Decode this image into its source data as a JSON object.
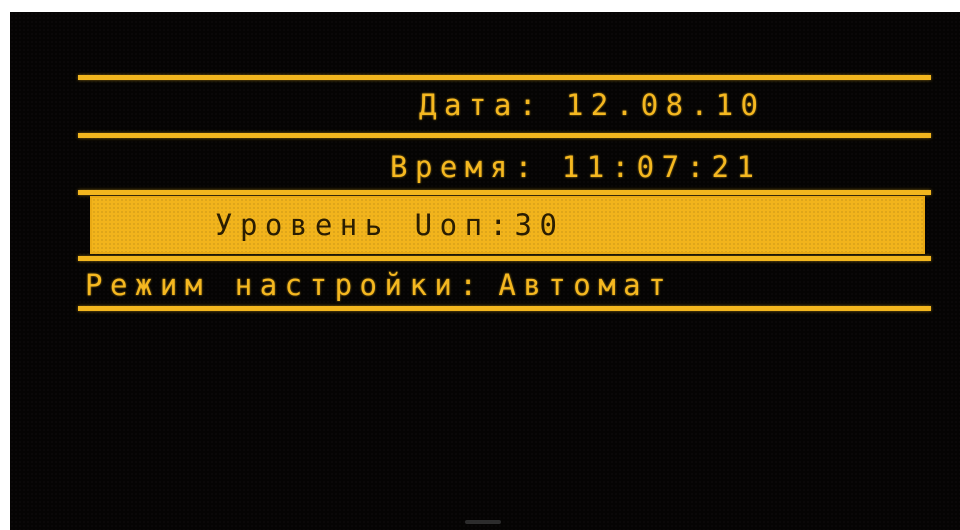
{
  "display": {
    "date": {
      "label": "Дата:",
      "value": "12.08.10"
    },
    "time": {
      "label": "Время:",
      "value": "11:07:21"
    },
    "level": {
      "label": "Уровень Uоп:",
      "value": "30"
    },
    "mode": {
      "label": "Режим настройки:",
      "value": "Автомат"
    }
  },
  "colors": {
    "text": "#f5b820",
    "line": "#f2b61e",
    "highlight_bg": "#f2b41c",
    "highlight_text": "#2a1d02",
    "screen_bg": "#050403"
  }
}
